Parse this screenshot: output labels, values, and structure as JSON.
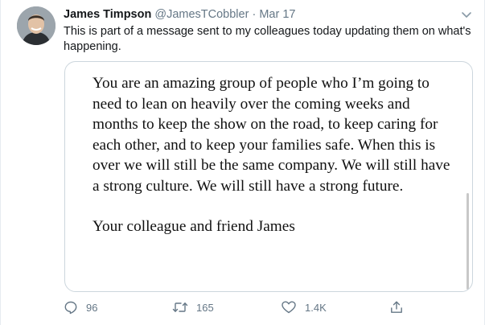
{
  "tweet": {
    "author_name": "James Timpson",
    "handle": "@JamesTCobbler",
    "separator": "·",
    "date": "Mar 17",
    "text": "This is part of a message sent to my colleagues today updating them on what's happening."
  },
  "image_card": {
    "paragraph1": "You are an amazing group of people who I’m going to need to lean on heavily over the coming weeks and months to keep the show on the road, to keep caring for each other, and to keep your families safe. When this is over we will still be the same company. We will still have a strong culture. We will still have a strong future.",
    "paragraph2": "Your colleague and friend James"
  },
  "actions": {
    "reply_count": "96",
    "retweet_count": "165",
    "like_count": "1.4K"
  },
  "icons": {
    "menu": "chevron-down-icon",
    "reply": "reply-icon",
    "retweet": "retweet-icon",
    "like": "heart-icon",
    "share": "share-icon"
  },
  "colors": {
    "text_primary": "#14171a",
    "text_secondary": "#657786",
    "border": "#ccd6dd"
  }
}
